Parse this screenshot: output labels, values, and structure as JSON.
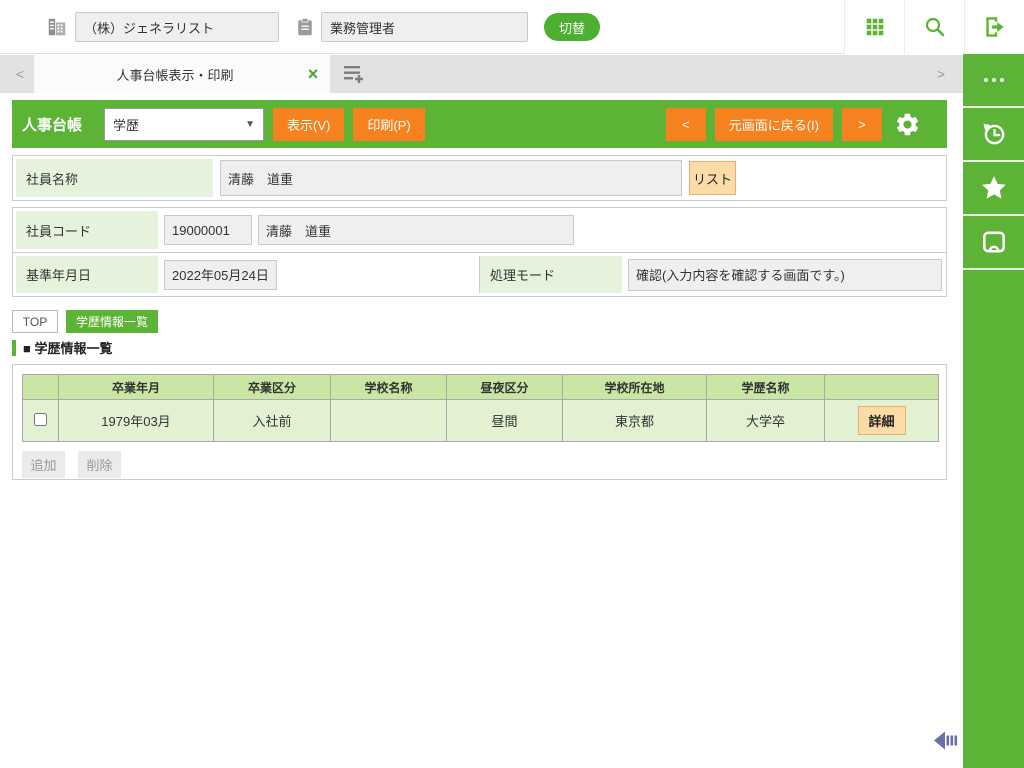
{
  "topbar": {
    "company_value": "（株）ジェネラリスト",
    "role_value": "業務管理者",
    "switch_label": "切替"
  },
  "tabbar": {
    "active_tab_label": "人事台帳表示・印刷",
    "close_glyph": "×",
    "prev_glyph": "<",
    "next_glyph": ">"
  },
  "command_bar": {
    "title": "人事台帳",
    "view_selected": "学歴",
    "select_arrow": "▼",
    "show_label": "表示(V)",
    "print_label": "印刷(P)",
    "prev_label": "<",
    "back_label": "元画面に戻る(I)",
    "next_label": ">"
  },
  "form": {
    "name_label": "社員名称",
    "name_value": "清藤　道重",
    "list_label": "リスト",
    "code_label": "社員コード",
    "code_value": "19000001",
    "code_name_value": "清藤　道重",
    "base_date_label": "基準年月日",
    "base_date_value": "2022年05月24日",
    "mode_label": "処理モード",
    "mode_value": "確認(入力内容を確認する画面です。)"
  },
  "subtabs": {
    "top_label": "TOP",
    "active_label": "学歴情報一覧"
  },
  "section_title": "■ 学歴情報一覧",
  "table": {
    "headers": [
      "卒業年月",
      "卒業区分",
      "学校名称",
      "昼夜区分",
      "学校所在地",
      "学歴名称"
    ],
    "row": {
      "graduation_ym": "1979年03月",
      "graduation_class": "入社前",
      "school_name": "",
      "day_night": "昼間",
      "school_location": "東京都",
      "education_name": "大学卒",
      "detail_label": "詳細"
    },
    "add_label": "追加",
    "delete_label": "削除"
  },
  "colors": {
    "green": "#5cb335",
    "orange": "#f5821e",
    "peach": "#fbdba6",
    "label_green": "#e5f2dc",
    "header_green": "#c9e6a4",
    "row_green": "#e2f1d2",
    "arrow_purple": "#6b6fa5"
  }
}
